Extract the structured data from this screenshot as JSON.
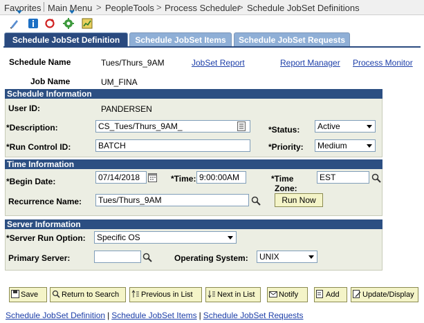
{
  "nav": {
    "favorites": "Favorites",
    "main_menu": "Main Menu",
    "crumbs": [
      "PeopleTools",
      "Process Scheduler",
      "Schedule JobSet Definitions"
    ],
    "separator": ">"
  },
  "toolbar_icons": [
    "edit-icon",
    "info-icon",
    "refresh-icon",
    "settings-icon",
    "chart-icon"
  ],
  "tabs": {
    "active": "Schedule JobSet Definition",
    "items": "Schedule JobSet Items",
    "requests": "Schedule JobSet Requests"
  },
  "header": {
    "schedule_name_label": "Schedule Name",
    "schedule_name_value": "Tues/Thurs_9AM",
    "job_name_label": "Job Name",
    "job_name_value": "UM_FINA",
    "link_jobset_report": "JobSet Report",
    "link_report_manager": "Report Manager",
    "link_process_monitor": "Process Monitor"
  },
  "schedule_info": {
    "title": "Schedule Information",
    "user_id_label": "User ID:",
    "user_id_value": "PANDERSEN",
    "description_label": "*Description:",
    "description_value": "CS_Tues/Thurs_9AM_",
    "status_label": "*Status:",
    "status_value": "Active",
    "run_control_label": "*Run Control ID:",
    "run_control_value": "BATCH",
    "priority_label": "*Priority:",
    "priority_value": "Medium"
  },
  "time_info": {
    "title": "Time Information",
    "begin_date_label": "*Begin Date:",
    "begin_date_value": "07/14/2018",
    "time_label": "*Time:",
    "time_value": "9:00:00AM",
    "timezone_label_1": "*Time",
    "timezone_label_2": "Zone:",
    "timezone_value": "EST",
    "recurrence_label": "Recurrence Name:",
    "recurrence_value": "Tues/Thurs_9AM",
    "run_now_label": "Run Now"
  },
  "server_info": {
    "title": "Server Information",
    "run_option_label": "*Server Run Option:",
    "run_option_value": "Specific OS",
    "primary_server_label": "Primary Server:",
    "primary_server_value": "",
    "os_label": "Operating System:",
    "os_value": "UNIX"
  },
  "buttons": {
    "save": "Save",
    "return": "Return to Search",
    "previous": "Previous in List",
    "next": "Next in List",
    "notify": "Notify",
    "add": "Add",
    "update": "Update/Display"
  },
  "bottom_links": {
    "definition": "Schedule JobSet Definition",
    "items": "Schedule JobSet Items",
    "requests": "Schedule JobSet Requests",
    "separator": "|"
  }
}
